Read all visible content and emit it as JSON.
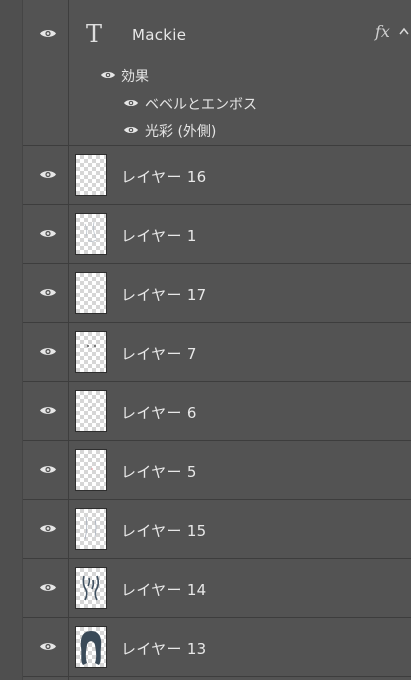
{
  "text_layer": {
    "name": "Mackie",
    "type_icon": "T",
    "fx_label": "fx",
    "effects_label": "効果",
    "effects": [
      {
        "label": "ベベルとエンボス"
      },
      {
        "label": "光彩 (外側)"
      }
    ]
  },
  "layers": [
    {
      "name": "レイヤー 16",
      "thumb": "blank"
    },
    {
      "name": "レイヤー 1",
      "thumb": "sketch-faint"
    },
    {
      "name": "レイヤー 17",
      "thumb": "blank"
    },
    {
      "name": "レイヤー 7",
      "thumb": "dots"
    },
    {
      "name": "レイヤー 6",
      "thumb": "tiny"
    },
    {
      "name": "レイヤー 5",
      "thumb": "pink-dot"
    },
    {
      "name": "レイヤー 15",
      "thumb": "lines"
    },
    {
      "name": "レイヤー 14",
      "thumb": "dark-strokes"
    },
    {
      "name": "レイヤー 13",
      "thumb": "hair-silhouette"
    }
  ],
  "colors": {
    "panel_bg": "#535353",
    "divider": "#3d3d3d",
    "text": "#e8e8e8",
    "hair": "#3a4a58"
  }
}
